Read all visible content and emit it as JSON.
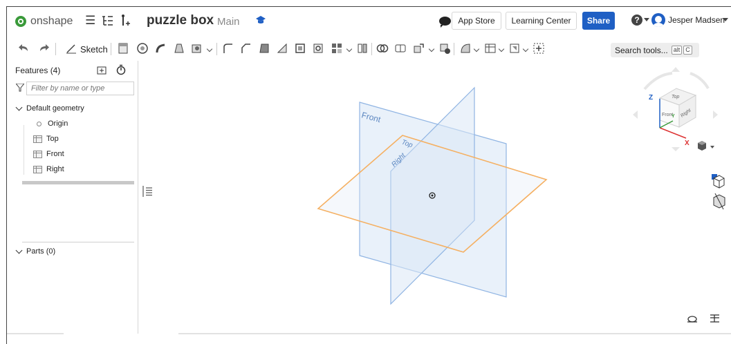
{
  "app": {
    "name": "onshape"
  },
  "document": {
    "title": "puzzle box",
    "branch": "Main"
  },
  "header": {
    "app_store": "App Store",
    "learning_center": "Learning Center",
    "share": "Share",
    "help": "?",
    "user": "Jesper Madsen"
  },
  "toolbar": {
    "sketch": "Sketch",
    "search_label": "Search tools...",
    "shortcut_1": "alt",
    "shortcut_2": "C"
  },
  "features": {
    "title": "Features (4)",
    "filter_placeholder": "Filter by name or type",
    "default_geometry": "Default geometry",
    "items": [
      {
        "label": "Origin",
        "icon": "origin-icon"
      },
      {
        "label": "Top",
        "icon": "plane-icon"
      },
      {
        "label": "Front",
        "icon": "plane-icon"
      },
      {
        "label": "Right",
        "icon": "plane-icon"
      }
    ],
    "parts": "Parts (0)"
  },
  "viewport": {
    "plane_front": "Front",
    "plane_top": "Top",
    "plane_right": "Right",
    "cube_top": "Top",
    "cube_front": "Front",
    "cube_right": "Right",
    "axis_z": "Z",
    "axis_x": "X",
    "axis_y": "Y"
  },
  "colors": {
    "accent": "#1f5fc4",
    "brand": "#3a9a3a",
    "plane_blue": "#8fb4e3",
    "plane_orange": "#f5b062"
  }
}
